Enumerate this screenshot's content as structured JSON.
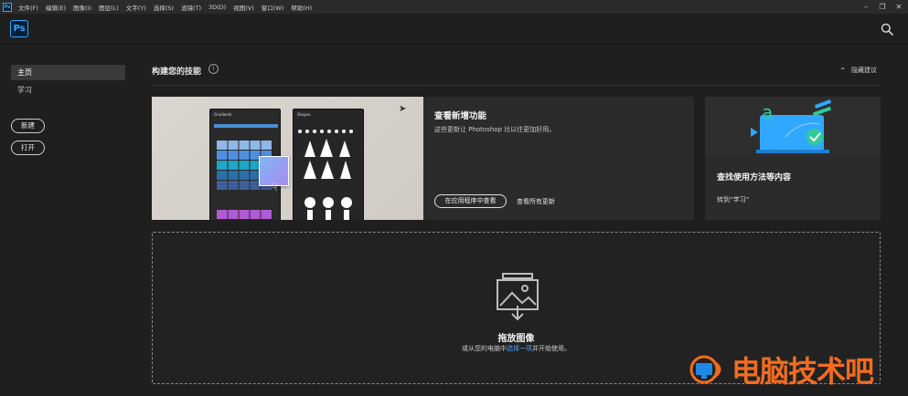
{
  "menubar": {
    "app_icon": "Ps",
    "items": [
      "文件(F)",
      "编辑(E)",
      "图像(I)",
      "图层(L)",
      "文字(Y)",
      "选择(S)",
      "滤镜(T)",
      "3D(D)",
      "视图(V)",
      "窗口(W)",
      "帮助(H)"
    ],
    "window_controls": [
      "minimize-icon",
      "restore-icon",
      "close-icon"
    ]
  },
  "header": {
    "logo": "Ps",
    "search_icon": "search-icon"
  },
  "sidebar": {
    "nav": [
      {
        "label": "主页",
        "active": true
      },
      {
        "label": "学习",
        "active": false
      }
    ],
    "buttons": {
      "new": "新建",
      "open": "打开"
    }
  },
  "main": {
    "section_title": "构建您的技能",
    "info_icon": "i",
    "hide_tips": "隐藏建议",
    "card_new_features": {
      "title": "查看新增功能",
      "description": "这些更新让 Photoshop 比以往更加好用。",
      "primary_button": "在应用程序中查看",
      "secondary_link": "查看所有更新",
      "panel_gradients": "Gradients",
      "panel_shapes": "Shapes"
    },
    "card_learn": {
      "title": "查找使用方法等内容",
      "link": "转到“学习”"
    },
    "dropzone": {
      "title": "拖放图像",
      "sub_before": "或从您的电脑中",
      "sub_link": "选择一项",
      "sub_after": "并开始使用。"
    }
  },
  "watermark": {
    "text": "电脑技术吧"
  },
  "colors": {
    "accent": "#31a8ff",
    "link": "#4fa3ff",
    "watermark": "#f26c1f"
  }
}
